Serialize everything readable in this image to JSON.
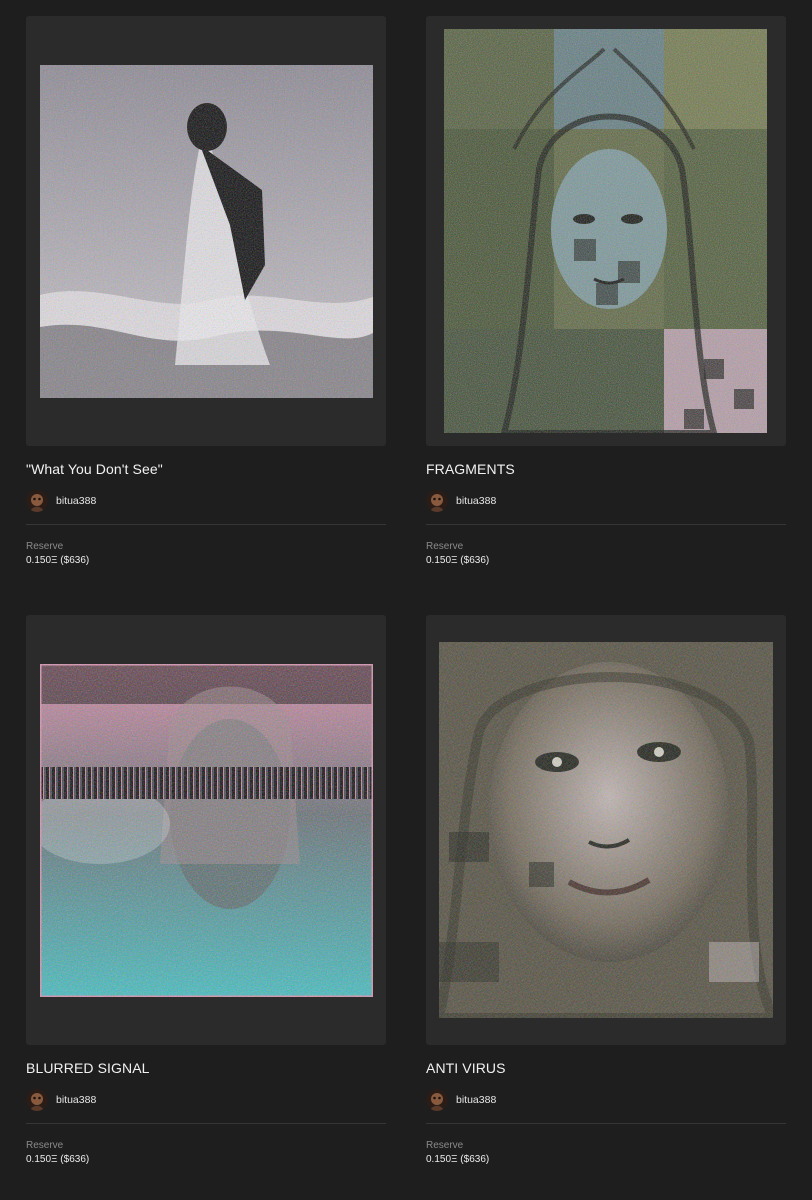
{
  "listings": [
    {
      "title": "\"What You Don't See\"",
      "creator": "bitua388",
      "reserve_label": "Reserve",
      "reserve_value": "0.150Ξ ($636)",
      "palette": [
        "#2b2b2b",
        "#a09aa6",
        "#d8d4dc",
        "#0c0a0e"
      ]
    },
    {
      "title": "FRAGMENTS",
      "creator": "bitua388",
      "reserve_label": "Reserve",
      "reserve_value": "0.150Ξ ($636)",
      "palette": [
        "#2b2b2b",
        "#56603a",
        "#8fa0a0",
        "#0a0a08"
      ]
    },
    {
      "title": "BLURRED SIGNAL",
      "creator": "bitua388",
      "reserve_label": "Reserve",
      "reserve_value": "0.150Ξ ($636)",
      "palette": [
        "#2b2b2b",
        "#d48aa6",
        "#3fb6b8",
        "#121014"
      ]
    },
    {
      "title": "ANTI VIRUS",
      "creator": "bitua388",
      "reserve_label": "Reserve",
      "reserve_value": "0.150Ξ ($636)",
      "palette": [
        "#2b2b2b",
        "#7a6a5c",
        "#c8b8c0",
        "#0e0c0a"
      ]
    }
  ]
}
